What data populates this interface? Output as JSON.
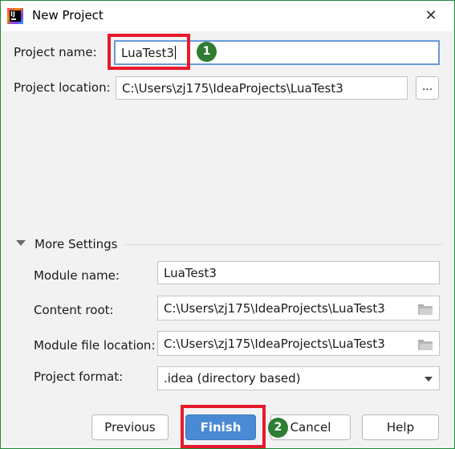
{
  "window": {
    "title": "New Project"
  },
  "form": {
    "project_name_label": "Project name:",
    "project_name_value": "LuaTest3",
    "project_location_label": "Project location:",
    "project_location_value": "C:\\Users\\zj175\\IdeaProjects\\LuaTest3",
    "browse_label": "..."
  },
  "more_settings": {
    "label": "More Settings",
    "module_name_label": "Module name:",
    "module_name_value": "LuaTest3",
    "content_root_label": "Content root:",
    "content_root_value": "C:\\Users\\zj175\\IdeaProjects\\LuaTest3",
    "module_file_location_label": "Module file location:",
    "module_file_location_value": "C:\\Users\\zj175\\IdeaProjects\\LuaTest3",
    "project_format_label": "Project format:",
    "project_format_value": ".idea (directory based)"
  },
  "buttons": {
    "previous": "Previous",
    "finish": "Finish",
    "cancel": "Cancel",
    "help": "Help"
  },
  "annotations": {
    "step1": "1",
    "step2": "2",
    "box_color": "#e8192c",
    "badge_color": "#2e7d32"
  },
  "icons": {
    "app": "intellij-idea-icon",
    "close": "close-icon",
    "folder": "folder-icon",
    "collapse": "triangle-down-icon",
    "dropdown": "chevron-down-icon"
  }
}
